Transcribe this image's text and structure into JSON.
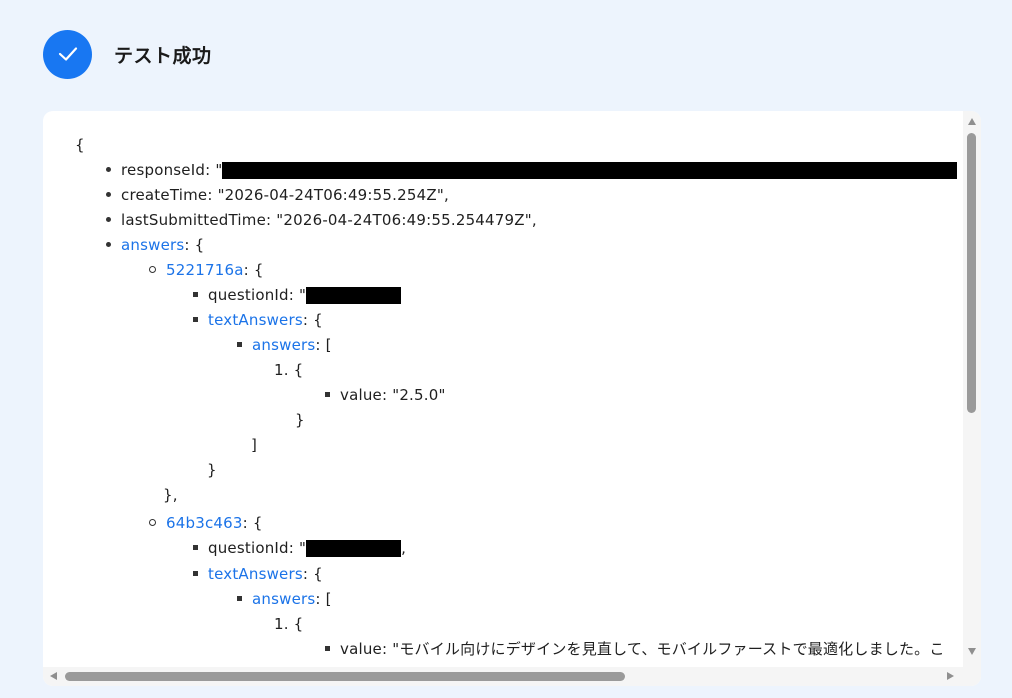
{
  "header": {
    "title": "テスト成功",
    "icon": "check-icon",
    "accent": "#1877f2"
  },
  "json": {
    "open": "{",
    "responseId_key": "responseId",
    "createTime_key": "createTime",
    "createTime_val": "\"2026-04-24T06:49:55.254Z\",",
    "lastSubmittedTime_key": "lastSubmittedTime",
    "lastSubmittedTime_val": "\"2026-04-24T06:49:55.254479Z\",",
    "answers_key": "answers",
    "colon_brace": ": {",
    "colon_bracket": ": [",
    "colon": ": ",
    "quote": "\"",
    "q1": {
      "id": "5221716a",
      "questionId_key": "questionId",
      "textAnswers_key": "textAnswers",
      "answers_key": "answers",
      "item_index": "1. {",
      "value_key": "value",
      "value_val": "\"2.5.0\"",
      "close_item": "}",
      "close_array": "]",
      "close_text": "}",
      "close_q": "},"
    },
    "q2": {
      "id": "64b3c463",
      "questionId_key": "questionId",
      "questionId_tail": ",",
      "textAnswers_key": "textAnswers",
      "answers_key": "answers",
      "item_index": "1. {",
      "value_key": "value",
      "value_val": "\"モバイル向けにデザインを見直して、モバイルファーストで最適化しました。こ"
    }
  }
}
